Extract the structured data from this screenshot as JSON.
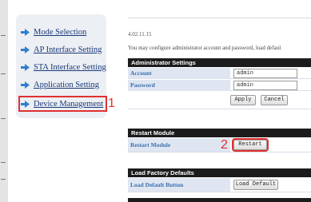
{
  "sidebar": {
    "items": [
      {
        "label": "Mode Selection"
      },
      {
        "label": "AP Interface Setting"
      },
      {
        "label": "STA Interface Setting"
      },
      {
        "label": "Application Setting"
      },
      {
        "label": "Device Management"
      }
    ],
    "arrow_color": "#2f7fd0"
  },
  "annotations": {
    "step1": "1",
    "step2": "2",
    "color": "#e03030"
  },
  "main": {
    "version": "4.02.11.15",
    "description": "You may configure administrator account and password, load defaul",
    "admin_settings": {
      "title": "Administrator Settings",
      "account_label": "Account",
      "account_value": "admin",
      "password_label": "Password",
      "password_value": "admin",
      "apply_label": "Apply",
      "cancel_label": "Cancel"
    },
    "restart_module": {
      "title": "Restart Module",
      "row_label": "Restart Module",
      "button_label": "Restart"
    },
    "factory_defaults": {
      "title": "Load Factory Defaults",
      "row_label": "Load Default Button",
      "button_label": "Load Default"
    }
  }
}
